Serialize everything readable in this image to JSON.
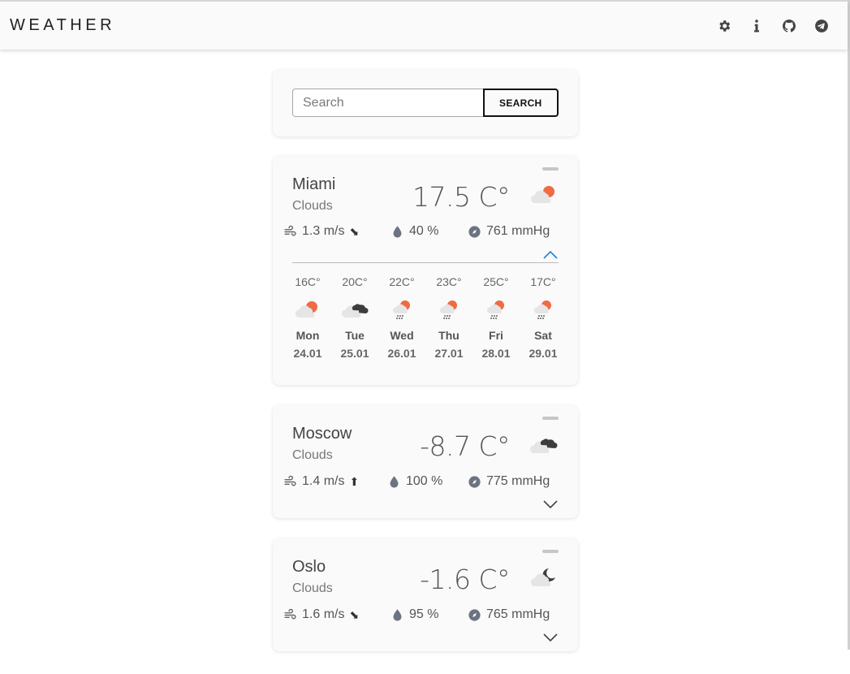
{
  "app": {
    "title": "WEATHER",
    "icons": [
      "gear-icon",
      "info-icon",
      "github-icon",
      "telegram-icon"
    ]
  },
  "search": {
    "placeholder": "Search",
    "value": "",
    "button_label": "SEARCH"
  },
  "colors": {
    "sun": "#ef6b43",
    "dark_cloud": "#3d3d3d",
    "light_cloud": "#e5e5e5",
    "accent": "#2a7fd4"
  },
  "cities": [
    {
      "name": "Miami",
      "description": "Clouds",
      "temperature": "17.5 C°",
      "icon": "cloud-sun-icon",
      "wind": "1.3 m/s",
      "wind_arrow": "⬊",
      "humidity": "40 %",
      "pressure": "761 mmHg",
      "expanded": true,
      "forecast": [
        {
          "temp": "16C°",
          "icon": "cloud-sun-icon",
          "day": "Mon",
          "date": "24.01"
        },
        {
          "temp": "20C°",
          "icon": "clouds-dark-icon",
          "day": "Tue",
          "date": "25.01"
        },
        {
          "temp": "22C°",
          "icon": "rain-sun-icon",
          "day": "Wed",
          "date": "26.01"
        },
        {
          "temp": "23C°",
          "icon": "rain-sun-icon",
          "day": "Thu",
          "date": "27.01"
        },
        {
          "temp": "25C°",
          "icon": "rain-sun-icon",
          "day": "Fri",
          "date": "28.01"
        },
        {
          "temp": "17C°",
          "icon": "rain-sun-icon",
          "day": "Sat",
          "date": "29.01"
        }
      ]
    },
    {
      "name": "Moscow",
      "description": "Clouds",
      "temperature": "-8.7 C°",
      "icon": "clouds-dark-icon",
      "wind": "1.4 m/s",
      "wind_arrow": "⬆",
      "humidity": "100 %",
      "pressure": "775 mmHg",
      "expanded": false
    },
    {
      "name": "Oslo",
      "description": "Clouds",
      "temperature": "-1.6 C°",
      "icon": "cloud-moon-icon",
      "wind": "1.6 m/s",
      "wind_arrow": "⬊",
      "humidity": "95 %",
      "pressure": "765 mmHg",
      "expanded": false
    }
  ]
}
